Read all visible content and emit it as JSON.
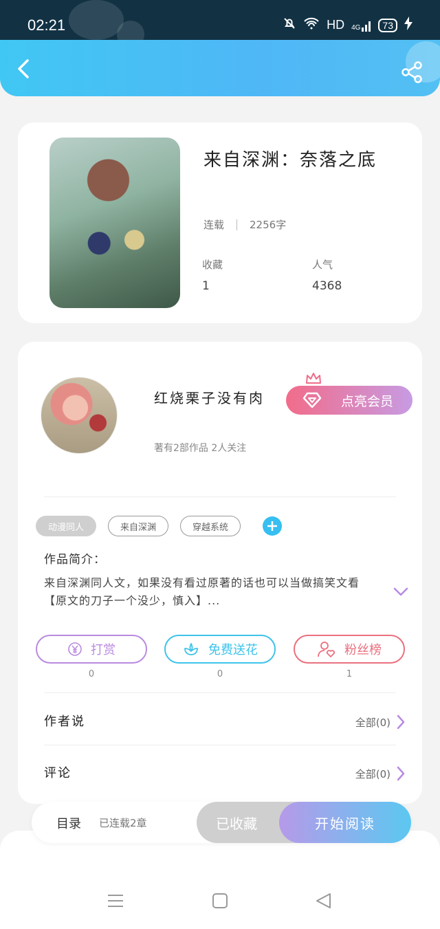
{
  "status_bar": {
    "time": "02:21",
    "network": "HD",
    "signal": "4G",
    "battery": "73"
  },
  "book": {
    "title": "来自深渊：奈落之底",
    "status": "连载",
    "word_count": "2256字",
    "favorites_label": "收藏",
    "favorites_value": "1",
    "popularity_label": "人气",
    "popularity_value": "4368"
  },
  "author": {
    "name": "红烧栗子没有肉",
    "meta": "著有2部作品 2人关注",
    "vip_button": "点亮会员"
  },
  "tags": [
    "动漫同人",
    "来自深渊",
    "穿越系统"
  ],
  "intro": {
    "label": "作品简介：",
    "text": "来自深渊同人文，如果没有看过原著的话也可以当做搞笑文看【原文的刀子一个没少，慎入】..."
  },
  "actions": [
    {
      "label": "打赏",
      "count": "0",
      "color": "#b98ae0",
      "icon": "yen-icon"
    },
    {
      "label": "免费送花",
      "count": "0",
      "color": "#3ec3ea",
      "icon": "flower-icon"
    },
    {
      "label": "粉丝榜",
      "count": "1",
      "color": "#ea6f7e",
      "icon": "fan-icon"
    }
  ],
  "author_says": {
    "label": "作者说",
    "right": "全部(0)"
  },
  "comments": {
    "label": "评论",
    "right": "全部(0)"
  },
  "bottom_bar": {
    "toc_label": "目录",
    "toc_meta": "已连载2章",
    "collected": "已收藏",
    "start_read": "开始阅读"
  }
}
